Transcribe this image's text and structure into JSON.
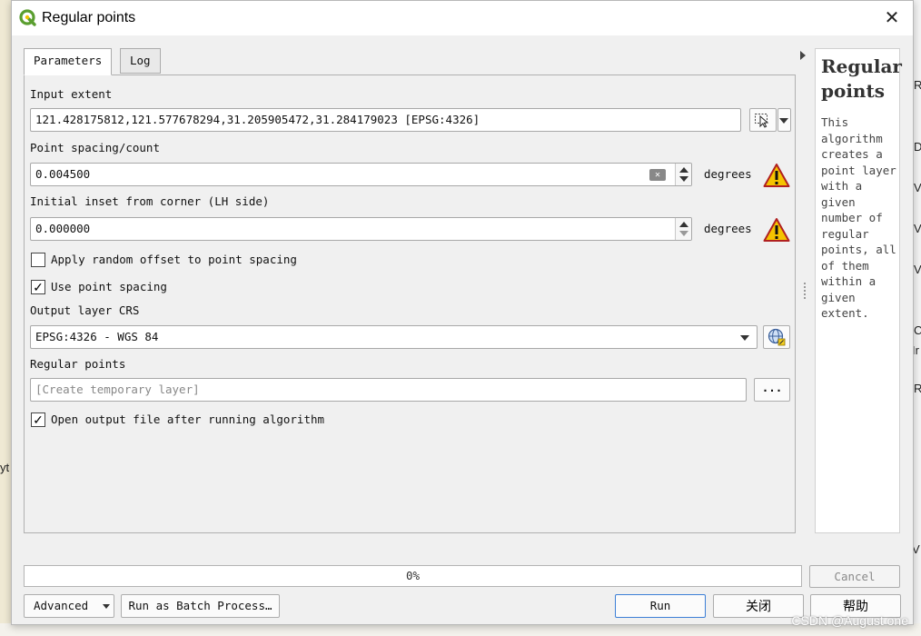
{
  "window": {
    "title": "Regular points",
    "close_glyph": "✕"
  },
  "tabs": [
    {
      "label": "Parameters",
      "active": true
    },
    {
      "label": "Log",
      "active": false
    }
  ],
  "params": {
    "input_extent": {
      "label": "Input extent",
      "value": "121.428175812,121.577678294,31.205905472,31.284179023 [EPSG:4326]"
    },
    "point_spacing": {
      "label": "Point spacing/count",
      "value": "0.004500",
      "unit": "degrees"
    },
    "initial_inset": {
      "label": "Initial inset from corner (LH side)",
      "value": "0.000000",
      "unit": "degrees"
    },
    "random_offset": {
      "label": "Apply random offset to point spacing",
      "checked": false
    },
    "use_spacing": {
      "label": "Use point spacing",
      "checked": true,
      "check_glyph": "✓"
    },
    "output_crs": {
      "label": "Output layer CRS",
      "value": "EPSG:4326 - WGS 84"
    },
    "regular_points": {
      "label": "Regular points",
      "placeholder": "[Create temporary layer]",
      "browse_label": "..."
    },
    "open_output": {
      "label": "Open output file after running algorithm",
      "checked": true,
      "check_glyph": "✓"
    }
  },
  "help": {
    "title": "Regular points",
    "description": "This algorithm creates a point layer with a given number of regular points, all of them within a given extent."
  },
  "progress": {
    "percent": 0,
    "label": "0%"
  },
  "buttons": {
    "cancel": "Cancel",
    "advanced": "Advanced",
    "batch": "Run as Batch Process…",
    "run": "Run",
    "close": "关闭",
    "help": "帮助"
  },
  "background": {
    "right_letters": [
      "R",
      "D",
      "V",
      "V",
      "V",
      "C",
      "Ir",
      "R",
      "V"
    ],
    "left_fragment": "yt",
    "watermark": "CSDN @August one"
  },
  "colors": {
    "warning_fill": "#f5c400",
    "accent": "#3c7fd6",
    "qgis_green": "#5a9e2f"
  },
  "icons": {
    "app": "qgis-logo-icon",
    "extent": "map-extent-cursor-icon",
    "warning": "warning-triangle-icon",
    "crs": "globe-crs-icon",
    "clear": "clear-field-icon"
  }
}
